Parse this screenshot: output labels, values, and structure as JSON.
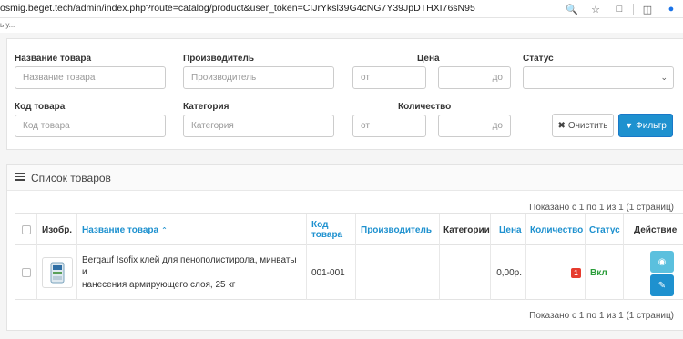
{
  "browser": {
    "url": "osmig.beget.tech/admin/index.php?route=catalog/product&user_token=CIJrYksl39G4cNG7Y39JpDTHXI76sN95",
    "bookmark_text": "ь у..."
  },
  "filter": {
    "name_label": "Название товара",
    "name_placeholder": "Название товара",
    "manufacturer_label": "Производитель",
    "manufacturer_placeholder": "Производитель",
    "price_label": "Цена",
    "price_from_placeholder": "от",
    "price_to_placeholder": "до",
    "status_label": "Статус",
    "status_value": "",
    "code_label": "Код товара",
    "code_placeholder": "Код товара",
    "category_label": "Категория",
    "category_placeholder": "Категория",
    "quantity_label": "Количество",
    "qty_from_placeholder": "от",
    "qty_to_placeholder": "до",
    "clear_label": "Очистить",
    "filter_label": "Фильтр"
  },
  "list": {
    "title": "Список товаров",
    "pagination_top": "Показано с 1 по 1 из 1 (1 страниц)",
    "pagination_bottom": "Показано с 1 по 1 из 1 (1 страниц)",
    "columns": {
      "image": "Изобр.",
      "name": "Название товара",
      "code_line1": "Код",
      "code_line2": "товара",
      "manufacturer": "Производитель",
      "categories": "Категории",
      "price": "Цена",
      "quantity": "Количество",
      "status": "Статус",
      "action": "Действие"
    },
    "rows": [
      {
        "name_line1": "Bergauf Isofix клей для пенополистирола, минваты и",
        "name_line2": "нанесения армирующего слоя, 25 кг",
        "code": "001-001",
        "manufacturer": "",
        "categories": "",
        "price": "0,00р.",
        "quantity": "1",
        "status": "Вкл"
      }
    ]
  },
  "colors": {
    "primary": "#1e91cf",
    "info": "#5bc0de",
    "danger": "#e63b2e",
    "success": "#2a9d3a"
  }
}
